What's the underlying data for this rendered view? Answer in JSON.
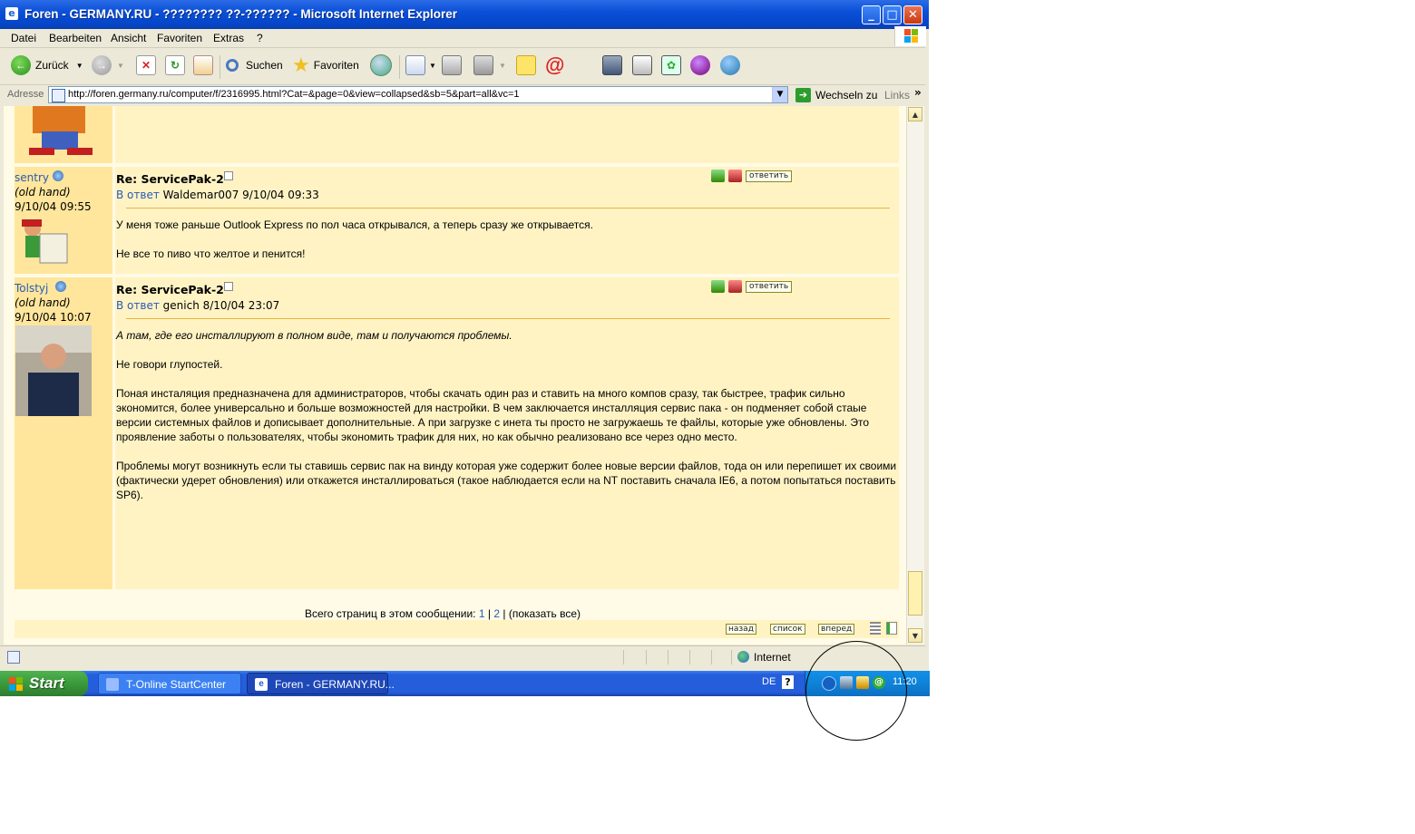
{
  "window": {
    "title": "Foren - GERMANY.RU - ???????? ??-?????? - Microsoft Internet Explorer",
    "minimize": "_",
    "maximize": "□",
    "close": "✕"
  },
  "menu": [
    "Datei",
    "Bearbeiten",
    "Ansicht",
    "Favoriten",
    "Extras",
    "?"
  ],
  "toolbar": {
    "back": "Zurück",
    "search": "Suchen",
    "favorites": "Favoriten"
  },
  "address": {
    "label": "Adresse",
    "url": "http://foren.germany.ru/computer/f/2316995.html?Cat=&page=0&view=collapsed&sb=5&part=all&vc=1",
    "go": "Wechseln zu",
    "links": "Links",
    "more": "»"
  },
  "posts": [
    {
      "author": "sentry",
      "role": "(old hand)",
      "date": "9/10/04 09:55",
      "subject": "Re: ServicePak-2",
      "reply_prefix": "В ответ",
      "reply_to": "Waldemar007 9/10/04 09:33",
      "answer": "ответить",
      "paragraphs": [
        "У меня тоже раньше Outlook Express по пол часа открывался, а теперь сразу же открывается.",
        "Не все то пиво что желтое и пенится!"
      ]
    },
    {
      "author": "Tolstyj",
      "role": "(old hand)",
      "date": "9/10/04 10:07",
      "subject": "Re: ServicePak-2",
      "reply_prefix": "В ответ",
      "reply_to": "genich 8/10/04 23:07",
      "answer": "ответить",
      "quote": "А там, где его инсталлируют в полном виде, там и получаются проблемы.",
      "paragraphs": [
        "Не говори глупостей.",
        "Поная инсталяция предназначена для администраторов, чтобы скачать один раз и ставить на много компов сразу, так быстрее, трафик сильно экономится, более универсально и больше возможностей для настройки. В чем заключается инсталляция сервис пака - он подменяет собой стаые версии системных файлов и дописывает дополнительные. А при загрузке с инета ты просто не загружаешь те файлы, которые уже обновлены. Это проявление заботы о пользователях, чтобы экономить трафик для них, но как обычно реализовано все через одно место.",
        "Проблемы могут возникнуть если ты ставишь сервис пак на винду которая уже содержит более новые версии файлов, тода он или перепишет их своими (фактически удерет обновления) или откажется инсталлироваться (такое наблюдается если на NT поставить сначала IE6, а потом попытаться поставить SP6)."
      ]
    }
  ],
  "pager": {
    "label": "Всего страниц в этом сообщении:",
    "page1": "1",
    "sep1": "|",
    "page2": "2",
    "sep2": "|",
    "show_all": "(показать все)"
  },
  "nav": {
    "back": "назад",
    "list": "список",
    "forward": "вперед"
  },
  "status": {
    "zone": "Internet"
  },
  "taskbar": {
    "start": "Start",
    "tasks": [
      "T-Online StartCenter",
      "Foren - GERMANY.RU..."
    ],
    "lang": "DE",
    "help": "?",
    "clock": "11:20"
  },
  "colors": {
    "post_left": "#ffe69c",
    "post_right": "#fff3c4",
    "link": "#2a5ab5",
    "xp_blue": "#0a50d8"
  }
}
